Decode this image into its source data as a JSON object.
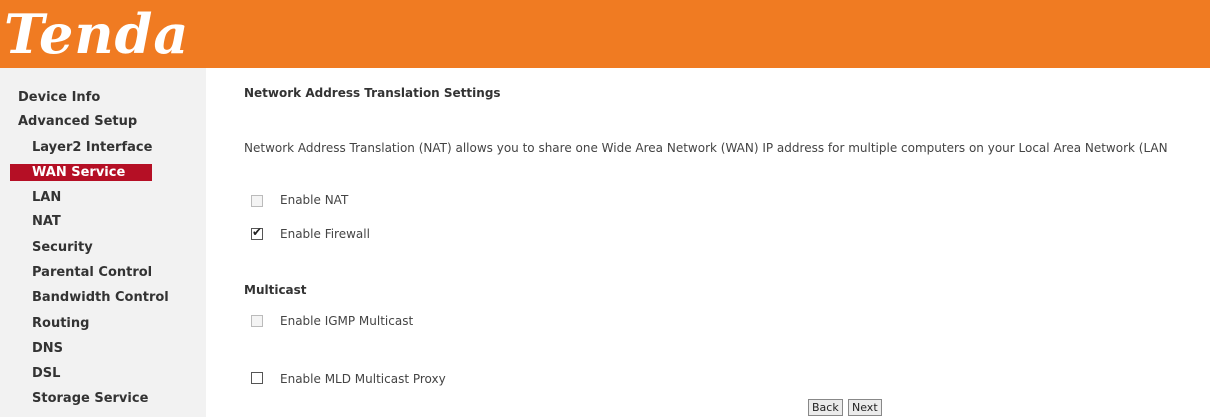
{
  "header": {
    "logo_text": "Tenda",
    "background_color": "#f07b22"
  },
  "sidebar": {
    "active_color": "#b50f25",
    "items": [
      {
        "label": "Device Info"
      },
      {
        "label": "Advanced Setup"
      },
      {
        "label": "Layer2 Interface"
      },
      {
        "label": "WAN Service",
        "active": true
      },
      {
        "label": "LAN"
      },
      {
        "label": "NAT"
      },
      {
        "label": "Security"
      },
      {
        "label": "Parental Control"
      },
      {
        "label": "Bandwidth Control"
      },
      {
        "label": "Routing"
      },
      {
        "label": "DNS"
      },
      {
        "label": "DSL"
      },
      {
        "label": "Storage Service"
      }
    ]
  },
  "main": {
    "title": "Network Address Translation Settings",
    "description": "Network Address Translation (NAT) allows you to share one Wide Area Network (WAN) IP address for multiple computers on your Local Area Network (LAN",
    "options": {
      "enable_nat": {
        "label": "Enable NAT",
        "checked": false,
        "disabled": true
      },
      "enable_firewall": {
        "label": "Enable Firewall",
        "checked": true,
        "disabled": false
      }
    },
    "multicast": {
      "title": "Multicast",
      "enable_igmp": {
        "label": "Enable IGMP Multicast",
        "checked": false,
        "disabled": true
      },
      "enable_mld": {
        "label": "Enable MLD Multicast Proxy",
        "checked": false,
        "disabled": false
      }
    },
    "buttons": {
      "back": "Back",
      "next": "Next"
    }
  }
}
